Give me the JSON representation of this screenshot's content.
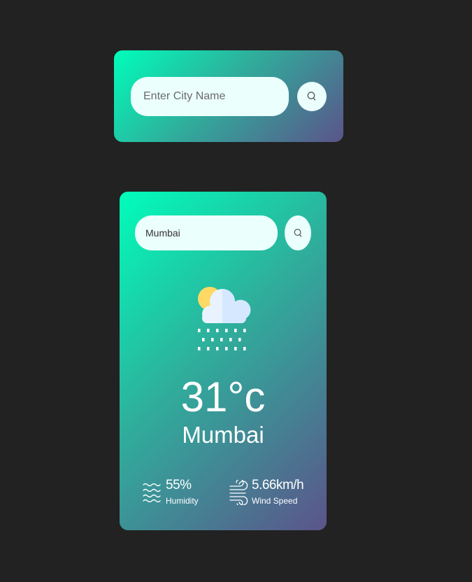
{
  "search_card": {
    "input_placeholder": "Enter City Name",
    "input_value": "",
    "search_icon": "search-icon"
  },
  "weather_card": {
    "input_value": "Mumbai",
    "search_icon": "search-icon",
    "weather_icon": "sun-cloud-rain-icon",
    "temperature": "31°c",
    "city": "Mumbai",
    "humidity": {
      "value": "55%",
      "label": "Humidity",
      "icon": "humidity-waves-icon"
    },
    "wind": {
      "value": "5.66km/h",
      "label": "Wind Speed",
      "icon": "wind-icon"
    }
  },
  "colors": {
    "background": "#222222",
    "gradient_start": "#00feba",
    "gradient_end": "#5b548a",
    "input_bg": "#ebfffc"
  }
}
